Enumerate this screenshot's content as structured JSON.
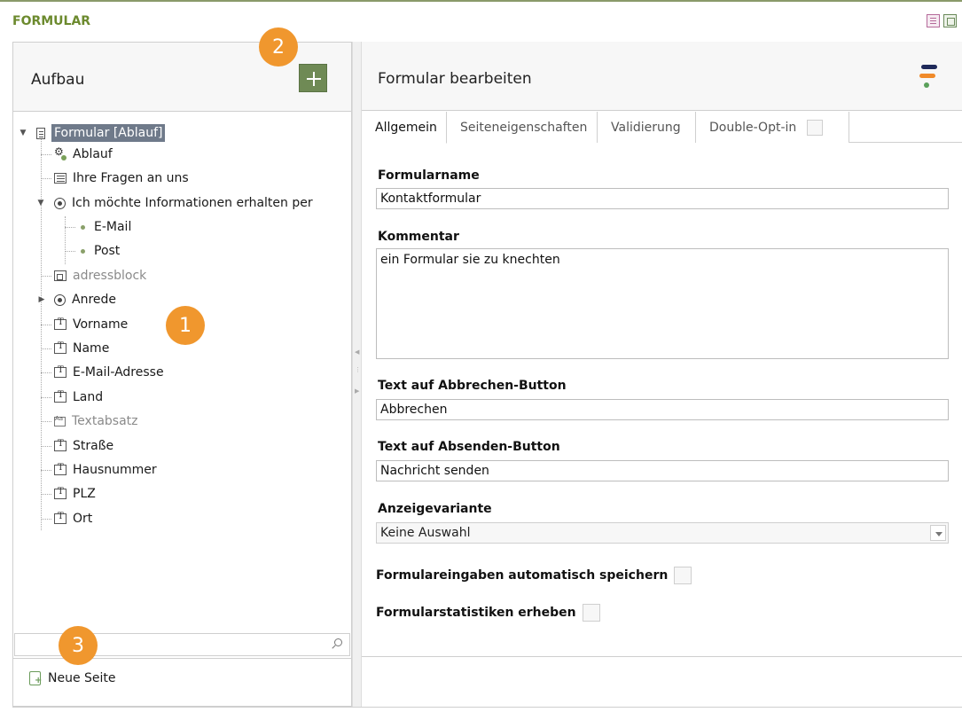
{
  "header": {
    "title": "FORMULAR",
    "icons": [
      "page-view-icon",
      "window-view-icon"
    ]
  },
  "left": {
    "title": "Aufbau",
    "add_button_icon": "plus-icon",
    "tree": [
      {
        "label": "Formular [Ablauf]",
        "icon": "document-icon",
        "selected": true,
        "expanded": true
      },
      {
        "label": "Ablauf",
        "icon": "gears-icon"
      },
      {
        "label": "Ihre Fragen an uns",
        "icon": "textarea-icon"
      },
      {
        "label": "Ich möchte Informationen erhalten per",
        "icon": "radio-icon",
        "expanded": true
      },
      {
        "label": "E-Mail",
        "icon": "option-dot-icon"
      },
      {
        "label": "Post",
        "icon": "option-dot-icon"
      },
      {
        "label": "adressblock",
        "icon": "block-icon",
        "muted": true
      },
      {
        "label": "Anrede",
        "icon": "radio-icon",
        "expanded": false
      },
      {
        "label": "Vorname",
        "icon": "textfield-icon"
      },
      {
        "label": "Name",
        "icon": "textfield-icon"
      },
      {
        "label": "E-Mail-Adresse",
        "icon": "textfield-icon"
      },
      {
        "label": "Land",
        "icon": "textfield-icon"
      },
      {
        "label": "Textabsatz",
        "icon": "text-paragraph-icon",
        "muted": true
      },
      {
        "label": "Straße",
        "icon": "textfield-icon"
      },
      {
        "label": "Hausnummer",
        "icon": "textfield-icon"
      },
      {
        "label": "PLZ",
        "icon": "textfield-icon"
      },
      {
        "label": "Ort",
        "icon": "textfield-icon"
      }
    ],
    "search": {
      "value": "",
      "placeholder": ""
    },
    "new_page_label": "Neue Seite"
  },
  "right": {
    "title": "Formular bearbeiten",
    "tabs": [
      {
        "label": "Allgemein",
        "active": true
      },
      {
        "label": "Seiteneigenschaften"
      },
      {
        "label": "Validierung"
      },
      {
        "label": "Double-Opt-in",
        "checkbox": true
      }
    ],
    "fields": {
      "name_label": "Formularname",
      "name_value": "Kontaktformular",
      "comment_label": "Kommentar",
      "comment_value": "ein Formular sie zu knechten",
      "cancel_label": "Text auf Abbrechen-Button",
      "cancel_value": "Abbrechen",
      "submit_label": "Text auf Absenden-Button",
      "submit_value": "Nachricht senden",
      "variant_label": "Anzeigevariante",
      "variant_value": "Keine Auswahl",
      "autosave_label": "Formulareingaben automatisch speichern",
      "stats_label": "Formularstatistiken erheben"
    }
  },
  "badges": [
    "1",
    "2",
    "3"
  ],
  "colors": {
    "accent": "#6f8a55",
    "badge": "#f0972e",
    "header_title": "#6c8a2e",
    "selected": "#6f7a8a"
  }
}
